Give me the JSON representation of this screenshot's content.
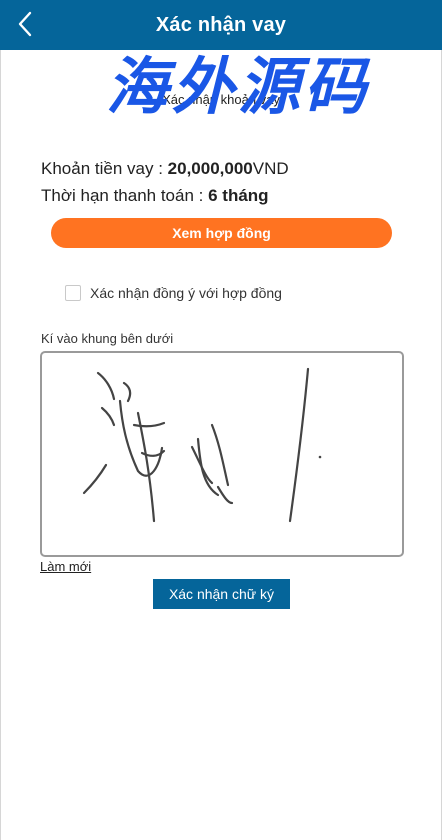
{
  "header": {
    "title": "Xác nhận vay",
    "back_icon": "chevron-left-icon"
  },
  "watermark": {
    "text": "海外源码",
    "color": "#1a57e6"
  },
  "subheading": "Xác nhận khoản vay",
  "loan": {
    "amount_label": "Khoản tiền vay :",
    "amount_value": "20,000,000",
    "amount_unit": "VND",
    "term_label": "Thời hạn thanh toán :",
    "term_value": "6 tháng"
  },
  "buttons": {
    "view_contract": "Xem hợp đồng",
    "reset": "Làm mới",
    "confirm_signature": "Xác nhận chữ ký"
  },
  "agreement": {
    "label": "Xác nhận đồng ý với hợp đồng",
    "checked": false
  },
  "signature": {
    "label": "Kí vào khung bên dưới"
  },
  "colors": {
    "header_bg": "#05659a",
    "accent_orange": "#ff7321",
    "confirm_bg": "#05659a"
  }
}
